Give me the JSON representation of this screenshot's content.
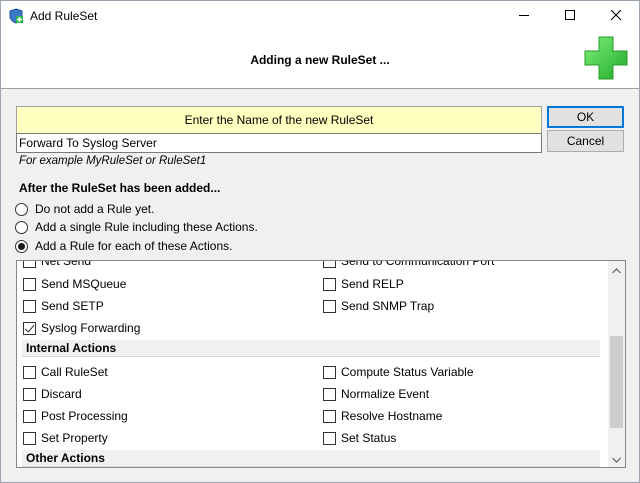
{
  "window": {
    "title": "Add RuleSet",
    "icons": {
      "app": "ruleset-app-icon",
      "minimize": "minimize-icon",
      "maximize": "maximize-icon",
      "close": "close-icon"
    }
  },
  "header": {
    "title": "Adding a new RuleSet ...",
    "icon": "green-plus-icon"
  },
  "name_section": {
    "label": "Enter the Name of the new RuleSet",
    "value": "Forward To Syslog Server",
    "example": "For example MyRuleSet or RuleSet1"
  },
  "buttons": {
    "ok": "OK",
    "cancel": "Cancel"
  },
  "after": {
    "label": "After the RuleSet has been added...",
    "options": [
      {
        "label": "Do not add a Rule yet.",
        "selected": false
      },
      {
        "label": "Add a single Rule including these Actions.",
        "selected": false
      },
      {
        "label": "Add a Rule for each of these Actions.",
        "selected": true
      }
    ]
  },
  "actions": {
    "top_partial": [
      "Net Send",
      "Send to Communication Port"
    ],
    "rows": [
      {
        "left": {
          "label": "Send MSQueue",
          "checked": false
        },
        "right": {
          "label": "Send RELP",
          "checked": false
        }
      },
      {
        "left": {
          "label": "Send SETP",
          "checked": false
        },
        "right": {
          "label": "Send SNMP Trap",
          "checked": false
        }
      },
      {
        "left": {
          "label": "Syslog Forwarding",
          "checked": true
        },
        "right": null
      }
    ],
    "groups": [
      {
        "title": "Internal Actions",
        "rows": [
          {
            "left": {
              "label": "Call RuleSet",
              "checked": false
            },
            "right": {
              "label": "Compute Status Variable",
              "checked": false
            }
          },
          {
            "left": {
              "label": "Discard",
              "checked": false
            },
            "right": {
              "label": "Normalize Event",
              "checked": false
            }
          },
          {
            "left": {
              "label": "Post Processing",
              "checked": false
            },
            "right": {
              "label": "Resolve Hostname",
              "checked": false
            }
          },
          {
            "left": {
              "label": "Set Property",
              "checked": false
            },
            "right": {
              "label": "Set Status",
              "checked": false
            }
          }
        ]
      },
      {
        "title": "Other Actions",
        "rows": []
      }
    ]
  }
}
